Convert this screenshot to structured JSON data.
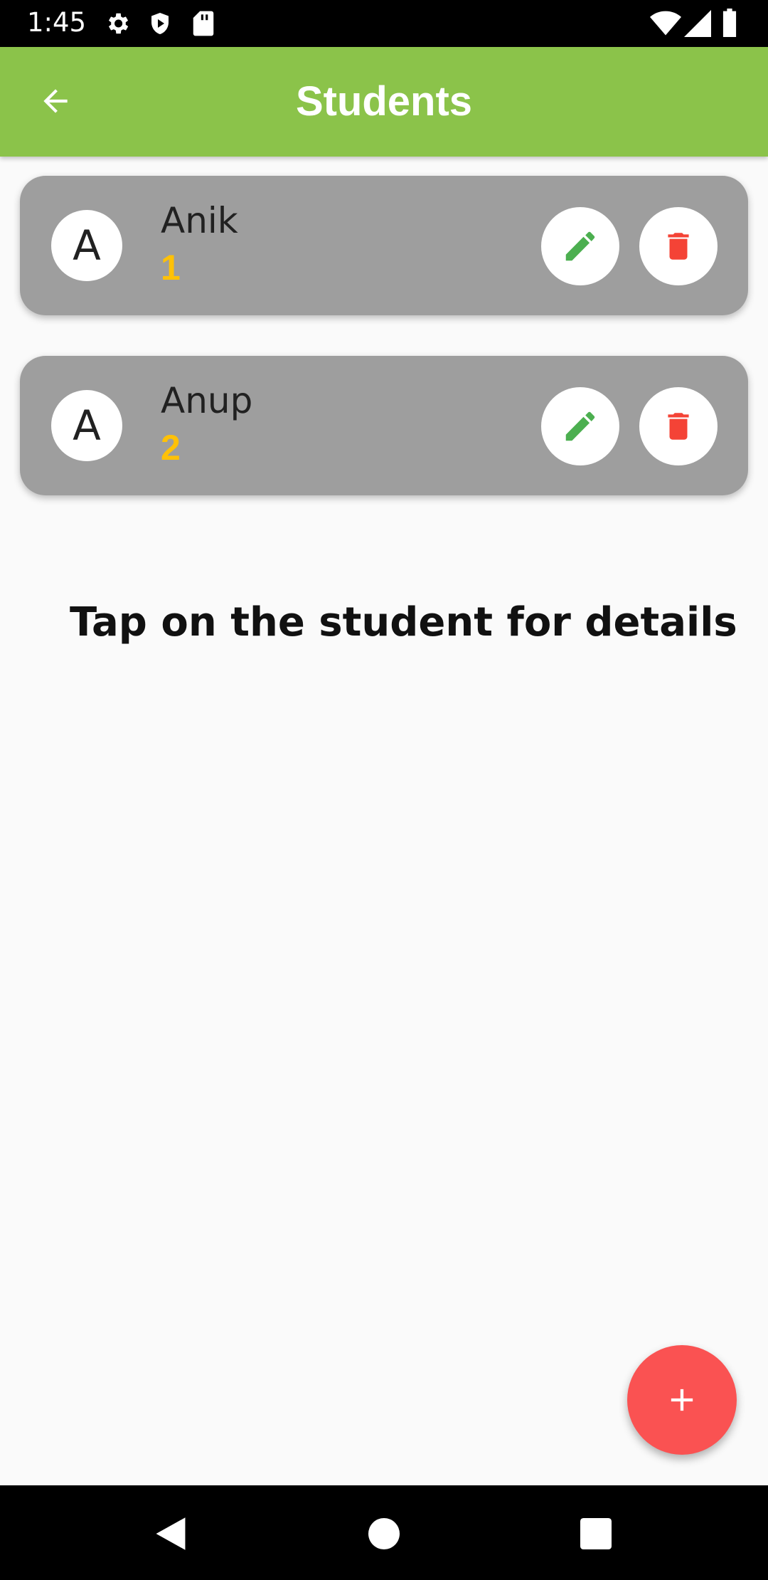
{
  "status_bar": {
    "time": "1:45",
    "icons": [
      "settings-icon",
      "shield-play-icon",
      "sd-card-icon",
      "wifi-icon",
      "signal-icon",
      "battery-icon"
    ]
  },
  "app_bar": {
    "title": "Students",
    "back_icon": "arrow-back-icon",
    "color": "#8bc34a"
  },
  "students": [
    {
      "initial": "A",
      "name": "Anik",
      "roll": "1"
    },
    {
      "initial": "A",
      "name": "Anup",
      "roll": "2"
    }
  ],
  "hint": "Tap on the student for details",
  "fab": {
    "icon": "plus-icon",
    "color": "#fa5252"
  },
  "colors": {
    "card": "#9e9e9e",
    "roll": "#ffc107",
    "edit_icon": "#4caf50",
    "delete_icon": "#f44336"
  },
  "nav_bar": {
    "icons": [
      "back-triangle-icon",
      "home-circle-icon",
      "recents-square-icon"
    ]
  }
}
